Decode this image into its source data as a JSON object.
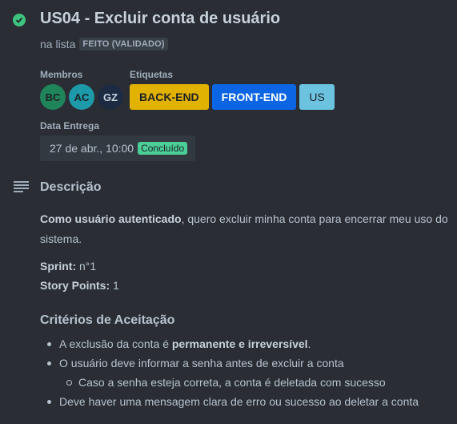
{
  "card": {
    "title": "US04 - Excluir conta de usuário",
    "list_prefix": "na lista",
    "list_name": "FEITO (VALIDADO)"
  },
  "members": {
    "label": "Membros",
    "items": [
      {
        "initials": "BC",
        "color": "#1f845a"
      },
      {
        "initials": "AC",
        "color": "#1d9aaa"
      },
      {
        "initials": "GZ",
        "color": "#1c2b42"
      }
    ]
  },
  "labels": {
    "label": "Etiquetas",
    "items": [
      {
        "text": "BACK-END",
        "bg": "#e2b203",
        "fg": "#1d2125"
      },
      {
        "text": "FRONT-END",
        "bg": "#0c66e4",
        "fg": "#ffffff"
      },
      {
        "text": "US",
        "bg": "#6cc3e0",
        "fg": "#1d2125"
      }
    ]
  },
  "due": {
    "label": "Data Entrega",
    "date": "27 de abr., 10:00",
    "status": "Concluído"
  },
  "description": {
    "heading": "Descrição",
    "intro_bold": "Como usuário autenticado",
    "intro_rest": ", quero excluir minha conta para encerrar meu uso do sistema.",
    "sprint_label": "Sprint:",
    "sprint_value": " n°1",
    "points_label": "Story Points:",
    "points_value": " 1",
    "criteria_heading": "Critérios de Aceitação",
    "criteria": {
      "c1_pre": "A exclusão da conta é ",
      "c1_bold": "permanente e irreversível",
      "c1_post": ".",
      "c2": "O usuário deve informar a senha antes de excluir a conta",
      "c2_sub": "Caso a senha esteja correta, a conta é deletada com sucesso",
      "c3": "Deve haver uma mensagem clara de erro ou sucesso ao deletar a conta"
    }
  }
}
